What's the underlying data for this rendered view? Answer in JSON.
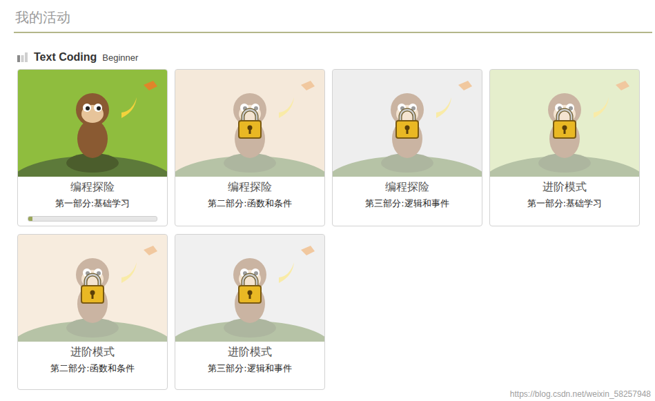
{
  "page": {
    "title": "我的活动"
  },
  "section": {
    "title": "Text Coding",
    "level": "Beginner",
    "difficulty": 1
  },
  "cards": [
    {
      "title": "编程探险",
      "subtitle": "第一部分:基础学习",
      "locked": false,
      "color": "#8fbd3e",
      "level": 0.03
    },
    {
      "title": "编程探险",
      "subtitle": "第二部分:函数和条件",
      "locked": true,
      "color": "#e8cfae"
    },
    {
      "title": "编程探险",
      "subtitle": "第三部分:逻辑和事件",
      "locked": true,
      "color": "#d9d9d9"
    },
    {
      "title": "进阶模式",
      "subtitle": "第一部分:基础学习",
      "locked": true,
      "color": "#c6d98f"
    },
    {
      "title": "进阶模式",
      "subtitle": "第二部分:函数和条件",
      "locked": true,
      "color": "#eed4b6"
    },
    {
      "title": "进阶模式",
      "subtitle": "第三部分:逻辑和事件",
      "locked": true,
      "color": "#dedede"
    }
  ],
  "watermark": "https://blog.csdn.net/weixin_58257948"
}
